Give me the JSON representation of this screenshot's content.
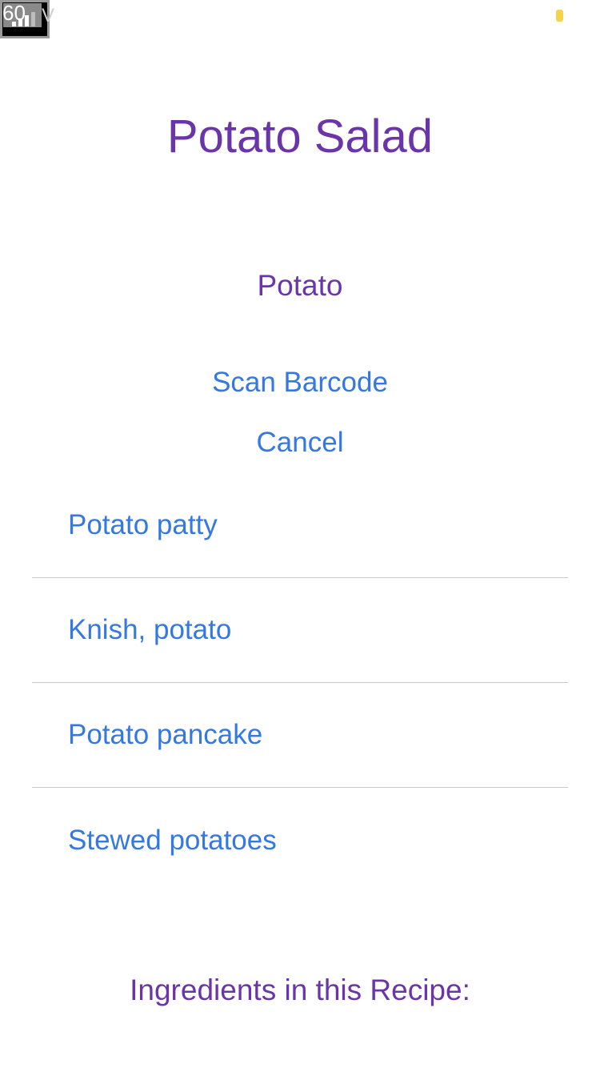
{
  "status_bar": {
    "debug_text": "60",
    "carrier_letter": "V",
    "icons": [
      "signal-icon",
      "battery-icon"
    ],
    "battery_color": "#f3d34a"
  },
  "recipe": {
    "title": "Potato Salad"
  },
  "search": {
    "term": "Potato"
  },
  "actions": {
    "scan_barcode": "Scan Barcode",
    "cancel": "Cancel"
  },
  "results": [
    {
      "label": "Potato patty"
    },
    {
      "label": "Knish, potato"
    },
    {
      "label": "Potato pancake"
    },
    {
      "label": "Stewed potatoes"
    }
  ],
  "ingredients": {
    "heading": "Ingredients in this Recipe:"
  },
  "colors": {
    "accent_purple": "#6a35a8",
    "link_blue": "#3478e0",
    "separator": "#c8c8cc"
  }
}
